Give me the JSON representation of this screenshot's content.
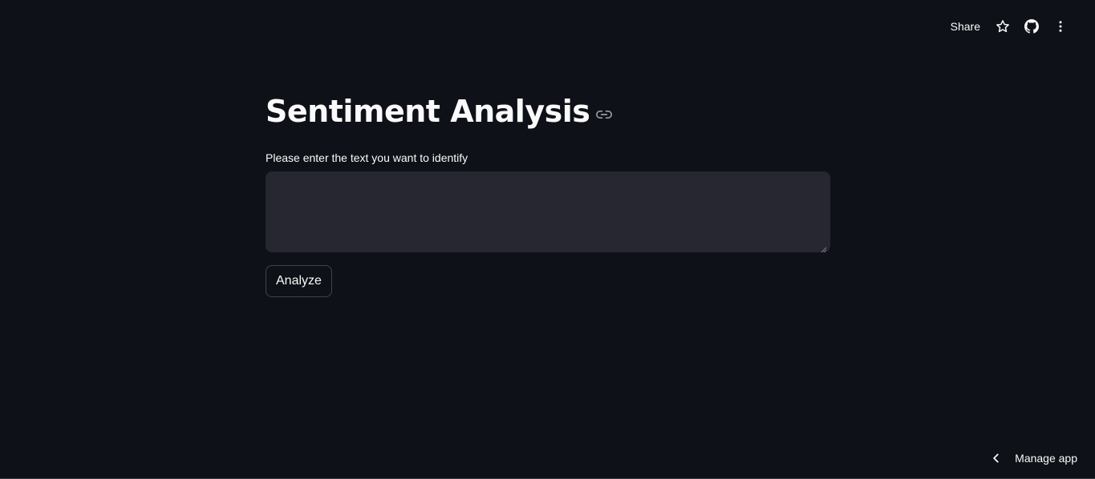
{
  "header": {
    "share_label": "Share",
    "icons": [
      "star-icon",
      "github-icon",
      "more-vertical-icon"
    ]
  },
  "main": {
    "title": "Sentiment Analysis",
    "title_icon": "link-icon",
    "input_label": "Please enter the text you want to identify",
    "input_value": "",
    "analyze_label": "Analyze"
  },
  "footer": {
    "manage_app_label": "Manage app",
    "manage_app_icon": "chevron-left-icon"
  },
  "colors": {
    "background": "#0e1117",
    "text": "#fafafa",
    "input_background": "#262730",
    "button_border": "#41444c",
    "icon_muted": "#9a9ca3"
  }
}
